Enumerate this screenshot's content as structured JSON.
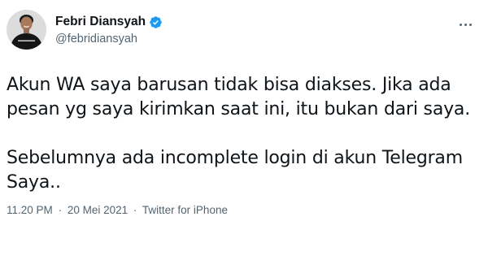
{
  "tweet": {
    "author": {
      "display_name": "Febri Diansyah",
      "handle": "@febridiansyah",
      "verified": true,
      "verified_icon": "verified-badge-icon",
      "verified_color": "#1d9bf0",
      "avatar_shirt_text": "KAMI ADALAH ANAK"
    },
    "more_icon": "more-options-icon",
    "text_lines": [
      "Akun WA saya barusan tidak bisa diakses. Jika ada",
      "pesan yg saya kirimkan saat ini, itu bukan dari saya.",
      "",
      "Sebelumnya ada incomplete login di akun Telegram",
      "Saya.."
    ],
    "meta": {
      "time": "11.20 PM",
      "date": "20 Mei 2021",
      "separator": "·",
      "source": "Twitter for iPhone"
    }
  },
  "colors": {
    "text_primary": "#0f1419",
    "text_secondary": "#536471",
    "accent": "#1d9bf0",
    "background": "#ffffff"
  }
}
